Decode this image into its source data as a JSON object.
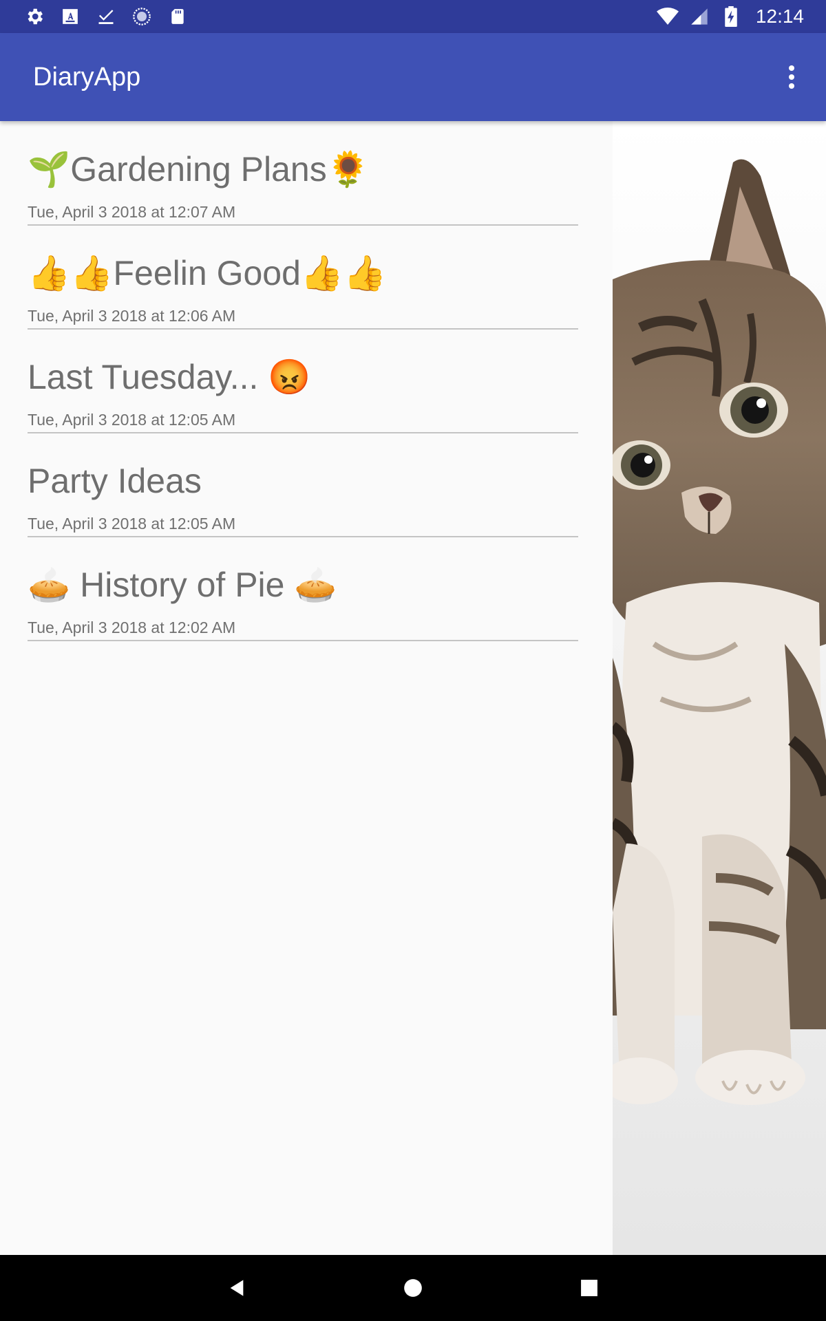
{
  "status_bar": {
    "time": "12:14",
    "left_icons": [
      "settings-icon",
      "keyboard-a-icon",
      "checkmark-icon",
      "sync-icon",
      "sd-card-icon"
    ],
    "right_icons": [
      "wifi-icon",
      "cell-signal-icon",
      "battery-charging-icon"
    ]
  },
  "app_bar": {
    "title": "DiaryApp",
    "overflow_icon": "more-vert-icon"
  },
  "entries": [
    {
      "title": "🌱Gardening Plans🌻",
      "date": "Tue, April 3 2018 at 12:07 AM"
    },
    {
      "title": "👍👍Feelin Good👍👍",
      "date": "Tue, April 3 2018 at 12:06 AM"
    },
    {
      "title": "Last Tuesday... 😡",
      "date": "Tue, April 3 2018 at 12:05 AM"
    },
    {
      "title": "Party Ideas",
      "date": "Tue, April 3 2018 at 12:05 AM"
    },
    {
      "title": "🥧 History of Pie 🥧",
      "date": "Tue, April 3 2018 at 12:02 AM"
    }
  ],
  "image_pane": {
    "subject": "kitten-photo"
  },
  "nav_bar": {
    "buttons": [
      "back-icon",
      "home-icon",
      "recents-icon"
    ]
  },
  "colors": {
    "status_bar": "#2f3b99",
    "app_bar": "#3f51b5",
    "background": "#fafafa",
    "divider": "#c4c4c4",
    "title_text": "#6e6e6e",
    "date_text": "#707070"
  }
}
